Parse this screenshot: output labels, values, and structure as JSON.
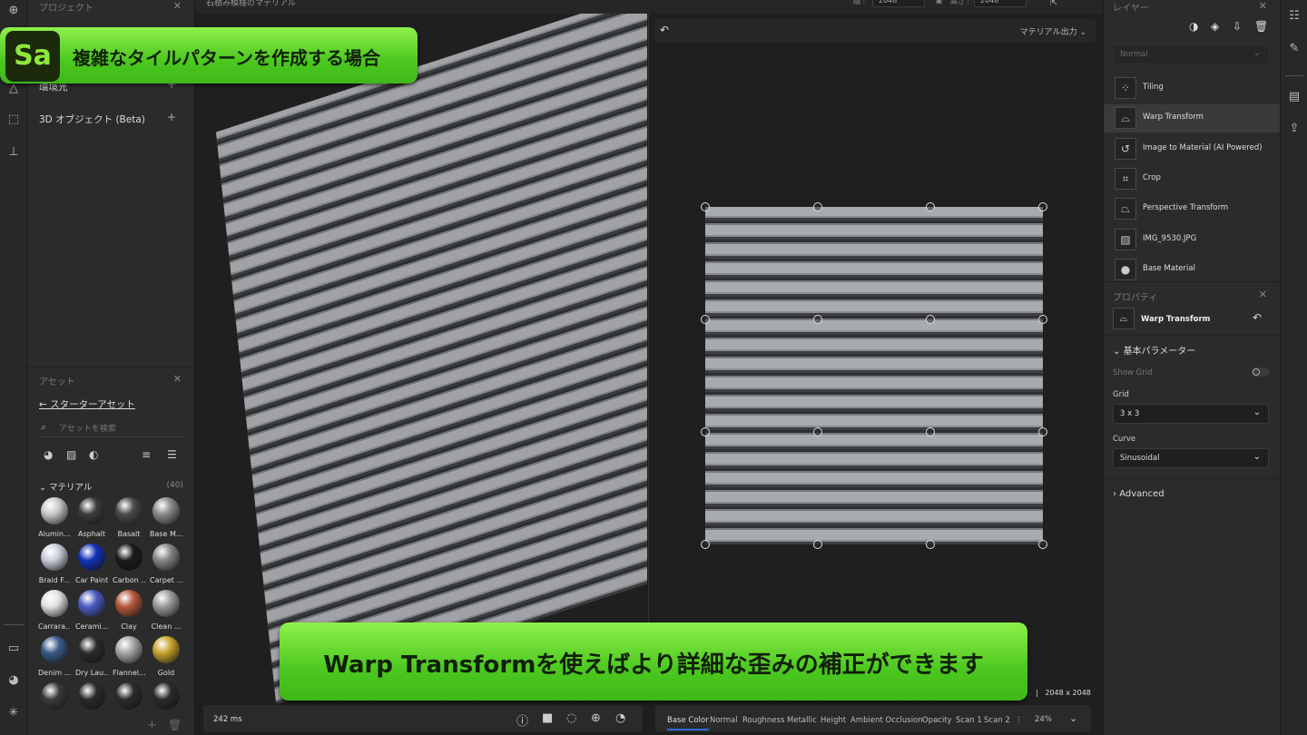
{
  "app": {
    "logo_text": "Sa",
    "document_title": "石積み模様のマテリアル"
  },
  "banners": {
    "top": "複雑なタイルパターンを作成する場合",
    "bottom": "Warp Transformを使えばより詳細な歪みの補正ができます"
  },
  "left_rail": {
    "icons": [
      "add-icon",
      "shape-icon",
      "select-frame-icon",
      "stamp-icon",
      "screen-share-icon",
      "palette-icon",
      "network-icon"
    ]
  },
  "project_panel": {
    "title": "プロジェクト",
    "rows": [
      {
        "label": "環境光"
      },
      {
        "label": "3D オブジェクト (Beta)"
      }
    ]
  },
  "assets_panel": {
    "title": "アセット",
    "back_link": "スターターアセット",
    "search_placeholder": "アセットを検索",
    "section_label": "マテリアル",
    "section_count": "(40)",
    "materials": [
      {
        "label": "Alumin...",
        "color": "#c8c8c8"
      },
      {
        "label": "Asphalt",
        "color": "#3c3c3c"
      },
      {
        "label": "Basalt",
        "color": "#4a4a4a"
      },
      {
        "label": "Base M...",
        "color": "#8a8a8a"
      },
      {
        "label": "Braid F...",
        "color": "#c9cdd8"
      },
      {
        "label": "Car Paint",
        "color": "#1230b8"
      },
      {
        "label": "Carbon ...",
        "color": "#1a1a1a"
      },
      {
        "label": "Carpet ...",
        "color": "#858585"
      },
      {
        "label": "Carrara...",
        "color": "#e0e0e0"
      },
      {
        "label": "Cerami...",
        "color": "#4a5cc0"
      },
      {
        "label": "Clay",
        "color": "#b5583a"
      },
      {
        "label": "Clean ...",
        "color": "#9a9a9a"
      },
      {
        "label": "Denim ...",
        "color": "#3a5a8a"
      },
      {
        "label": "Dry Lau...",
        "color": "#2b2b2b"
      },
      {
        "label": "Flannel...",
        "color": "#a6a6a6"
      },
      {
        "label": "Gold",
        "color": "#c9a22a"
      },
      {
        "label": "",
        "color": "#3a3a3a"
      },
      {
        "label": "",
        "color": "#2b2b2b"
      },
      {
        "label": "",
        "color": "#2b2b2b"
      },
      {
        "label": "",
        "color": "#2b2b2b"
      }
    ]
  },
  "topbar": {
    "width_label": "幅 :",
    "width_value": "2048",
    "height_label": "高さ :",
    "height_value": "2048"
  },
  "viewport2d": {
    "output_menu": "マテリアル出力",
    "resolution": "2048 x 2048",
    "zoom": "24%",
    "channels": [
      "Base Color",
      "Normal",
      "Roughness",
      "Metallic",
      "Height",
      "Ambient Occlusion",
      "Opacity",
      "Scan 1",
      "Scan 2"
    ],
    "active_channel": "Base Color"
  },
  "viewport3d": {
    "render_time": "242 ms"
  },
  "layers_panel": {
    "title": "レイヤー",
    "blend_mode": "Normal",
    "layers": [
      {
        "name": "Tiling",
        "icon": "tiling-icon",
        "selected": false
      },
      {
        "name": "Warp Transform",
        "icon": "warp-icon",
        "selected": true
      },
      {
        "name": "Image to Material (AI Powered)",
        "icon": "image-to-material-icon",
        "selected": false
      },
      {
        "name": "Crop",
        "icon": "crop-icon",
        "selected": false
      },
      {
        "name": "Perspective Transform",
        "icon": "perspective-icon",
        "selected": false
      },
      {
        "name": "IMG_9530.JPG",
        "icon": "image-icon",
        "selected": false
      },
      {
        "name": "Base Material",
        "icon": "sphere-icon",
        "selected": false
      }
    ]
  },
  "properties_panel": {
    "title": "プロパティ",
    "filter_name": "Warp Transform",
    "section_label": "基本パラメーター",
    "show_grid_label": "Show Grid",
    "show_grid_on": false,
    "grid_label": "Grid",
    "grid_value": "3 x 3",
    "curve_label": "Curve",
    "curve_value": "Sinusoidal",
    "advanced_label": "Advanced"
  }
}
